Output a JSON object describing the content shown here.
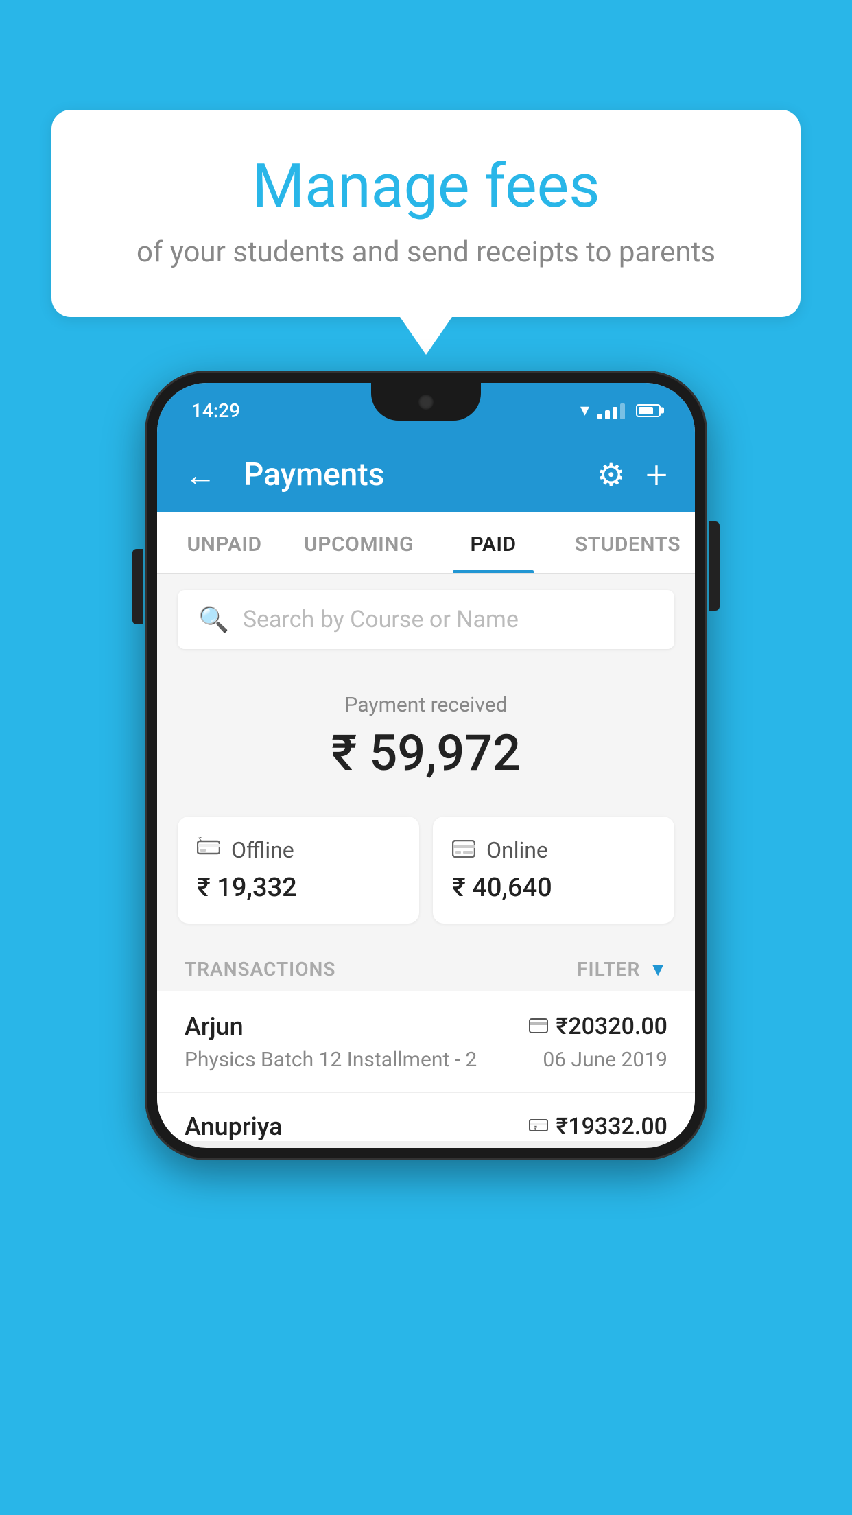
{
  "background_color": "#29b6e8",
  "bubble": {
    "title": "Manage fees",
    "subtitle": "of your students and send receipts to parents"
  },
  "status_bar": {
    "time": "14:29"
  },
  "toolbar": {
    "title": "Payments",
    "back_label": "←",
    "gear_label": "⚙",
    "plus_label": "+"
  },
  "tabs": [
    {
      "id": "unpaid",
      "label": "UNPAID",
      "active": false
    },
    {
      "id": "upcoming",
      "label": "UPCOMING",
      "active": false
    },
    {
      "id": "paid",
      "label": "PAID",
      "active": true
    },
    {
      "id": "students",
      "label": "STUDENTS",
      "active": false
    }
  ],
  "search": {
    "placeholder": "Search by Course or Name"
  },
  "payment_received": {
    "label": "Payment received",
    "amount": "₹ 59,972"
  },
  "payment_cards": [
    {
      "id": "offline",
      "icon": "🪙",
      "type": "Offline",
      "amount": "₹ 19,332"
    },
    {
      "id": "online",
      "icon": "💳",
      "type": "Online",
      "amount": "₹ 40,640"
    }
  ],
  "transactions_header": {
    "label": "TRANSACTIONS",
    "filter_label": "FILTER"
  },
  "transactions": [
    {
      "name": "Arjun",
      "amount": "₹20320.00",
      "icon": "card",
      "course": "Physics Batch 12 Installment - 2",
      "date": "06 June 2019"
    },
    {
      "name": "Anupriya",
      "amount": "₹19332.00",
      "icon": "cash",
      "course": "",
      "date": ""
    }
  ]
}
